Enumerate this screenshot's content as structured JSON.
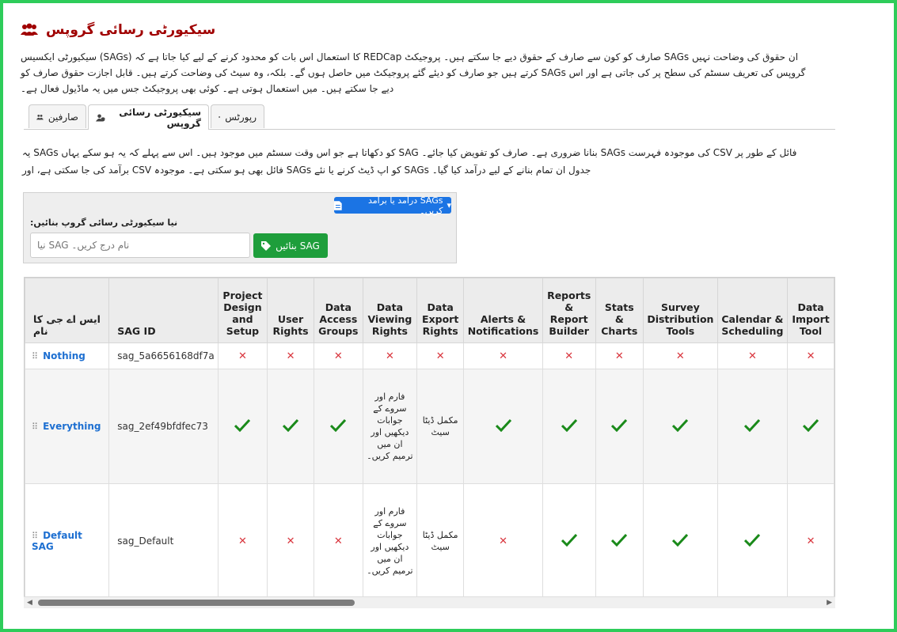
{
  "page": {
    "title": "سیکیورٹی رسائی گروپس",
    "intro": "ان حقوق کی وضاحت نہیں SAGs صارف کو کون سے صارف کے حقوق دیے جا سکتے ہیں۔ پروجیکٹ REDCap کا استعمال اس بات کو محدود کرنے کے لیے کیا جاتا ہے کہ (SAGs) سیکیورٹی ایکسیس گروپس کی تعریف سسٹم کی سطح پر کی جاتی ہے اور اس SAGs کرتے ہیں جو صارف کو دیئے گئے پروجیکٹ میں حاصل ہوں گے۔ بلکہ، وہ سیٹ کی وضاحت کرتے ہیں۔ قابل اجازت حقوق صارف کو دیے جا سکتے ہیں۔ میں استعمال ہوتی ہے۔ کوئی بھی پروجیکٹ جس میں یہ ماڈیول فعال ہے۔"
  },
  "tabs": [
    {
      "label": "صارفین"
    },
    {
      "label": "سیکیورٹی رسائی گروپس"
    },
    {
      "label": "رپورٹس"
    }
  ],
  "description": "فائل کے طور پر CSV کی موجودہ فہرست SAGs بنانا ضروری ہے۔ صارف کو تفویض کیا جائے۔ SAG کو دکھاتا ہے جو اس وقت سسٹم میں موجود ہیں۔ اس سے پہلے کہ یہ ہو سکے یہاں SAGs یہ جدول ان تمام بنانے کے لیے درآمد کیا گیا۔ SAGs کو اپ ڈیٹ کرنے یا نئے SAGs فائل بھی ہو سکتی ہے۔ موجودہ CSV برآمد کی جا سکتی ہے، اور",
  "toolbar": {
    "dropdown_label": "SAGs درآمد یا برآمد کریں۔",
    "new_label": "نیا سیکیورٹی رسائی گروپ بنائیں:",
    "input_placeholder": "نیا SAG نام درج کریں۔",
    "create_label": "SAG بنائیں"
  },
  "table": {
    "headers": [
      "ایس اے جی کا نام",
      "SAG ID",
      "Project Design and Setup",
      "User Rights",
      "Data Access Groups",
      "Data Viewing Rights",
      "Data Export Rights",
      "Alerts & Notifications",
      "Reports & Report Builder",
      "Stats & Charts",
      "Survey Distribution Tools",
      "Calendar & Scheduling",
      "Data Import Tool"
    ],
    "rows": [
      {
        "name": "Nothing",
        "id": "sag_5a6656168df7a",
        "cells": [
          "x",
          "x",
          "x",
          "x",
          "x",
          "x",
          "x",
          "x",
          "x",
          "x",
          "x"
        ]
      },
      {
        "name": "Everything",
        "id": "sag_2ef49bfdfec73",
        "cells": [
          "check",
          "check",
          "check",
          "فارم اور سروے کے جوابات دیکھیں اور ان میں ترمیم کریں۔",
          "مکمل ڈیٹا سیٹ",
          "check",
          "check",
          "check",
          "check",
          "check",
          "check"
        ]
      },
      {
        "name": "Default SAG",
        "id": "sag_Default",
        "cells": [
          "x",
          "x",
          "x",
          "فارم اور سروے کے جوابات دیکھیں اور ان میں ترمیم کریں۔",
          "مکمل ڈیٹا سیٹ",
          "x",
          "check",
          "check",
          "check",
          "check",
          "x"
        ]
      }
    ]
  },
  "colors": {
    "title": "#a00000",
    "accent": "#1b74e4",
    "create": "#1e9e3b",
    "cross": "#d9363e",
    "check": "#1a8a1a"
  }
}
